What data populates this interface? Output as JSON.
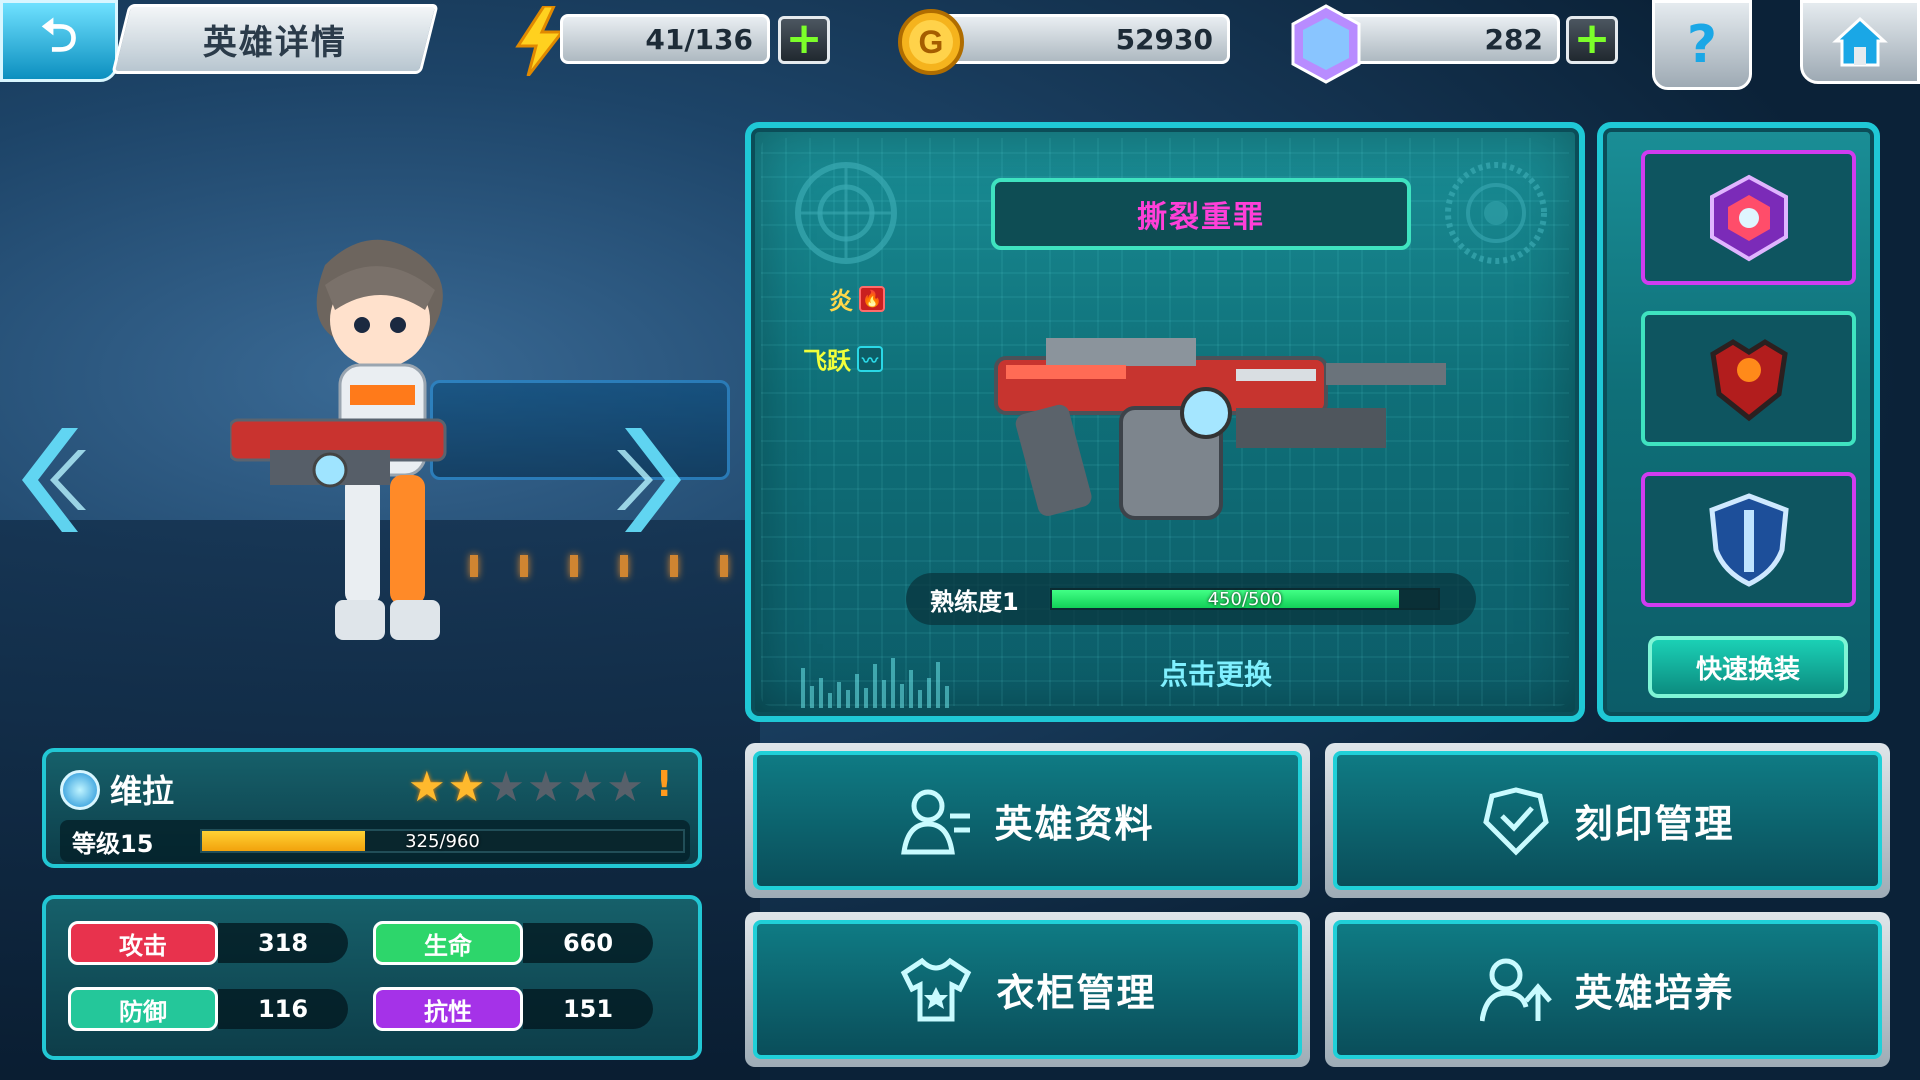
{
  "header": {
    "title": "英雄详情",
    "energy": "41/136",
    "gold": "52930",
    "gems": "282"
  },
  "weapon": {
    "name": "撕裂重罪",
    "elements": [
      {
        "label": "炎",
        "color": "#ffd84a",
        "chip_color": "#ff3b3b"
      },
      {
        "label": "飞跃",
        "color": "#f2ff3a",
        "chip_color": "#2ad8e6"
      }
    ],
    "proficiency_label": "熟练度1",
    "proficiency_value": "450/500",
    "proficiency_fraction": 0.9,
    "replace_label": "点击更换"
  },
  "slots": [
    {
      "icon": "armor-core-icon",
      "border": "purple"
    },
    {
      "icon": "chest-armor-icon",
      "border": "teal"
    },
    {
      "icon": "shield-icon",
      "border": "purple"
    }
  ],
  "quick_equip_label": "快速换装",
  "hero": {
    "name": "维拉",
    "stars_total": 6,
    "stars_filled": 2,
    "warning": "!",
    "level_label": "等级15",
    "xp": "325/960",
    "xp_fraction": 0.339
  },
  "stats": {
    "attack": {
      "label": "攻击",
      "value": "318",
      "color": "#e8324d"
    },
    "hp": {
      "label": "生命",
      "value": "660",
      "color": "#2dd66b"
    },
    "defense": {
      "label": "防御",
      "value": "116",
      "color": "#24c79a"
    },
    "resist": {
      "label": "抗性",
      "value": "151",
      "color": "#a532e8"
    }
  },
  "menu": {
    "hero_profile": "英雄资料",
    "imprint": "刻印管理",
    "wardrobe": "衣柜管理",
    "training": "英雄培养"
  },
  "colors": {
    "accent": "#1fc8d6",
    "weapon_name": "#ff3fd8",
    "proficiency": "#2ee86e",
    "xp": "#f6b51a"
  }
}
